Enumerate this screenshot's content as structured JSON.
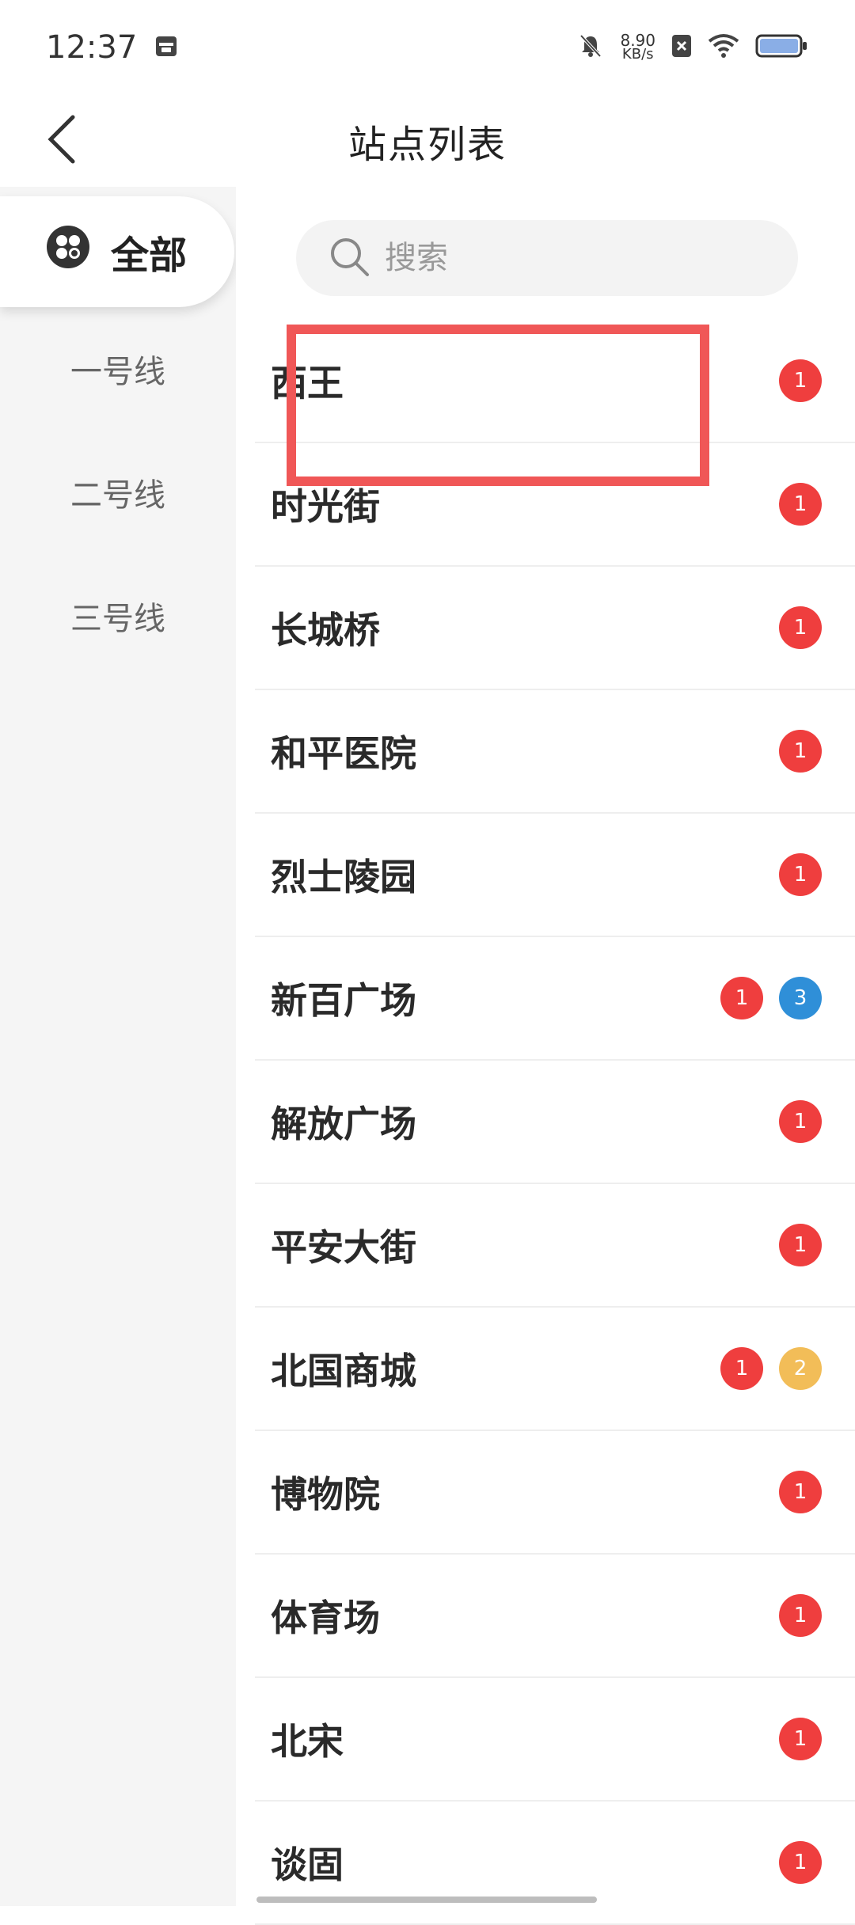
{
  "status_bar": {
    "time": "12:37",
    "speed_value": "8.90",
    "speed_unit": "KB/s"
  },
  "header": {
    "title": "站点列表"
  },
  "sidebar": {
    "items": [
      {
        "label": "全部",
        "active": true
      },
      {
        "label": "一号线"
      },
      {
        "label": "二号线"
      },
      {
        "label": "三号线"
      }
    ]
  },
  "search": {
    "placeholder": "搜索"
  },
  "colors": {
    "red": "#ef3e3e",
    "blue": "#2f8fd8",
    "yellow": "#f2bd58",
    "highlight": "#f05757"
  },
  "stations": [
    {
      "name": "西王",
      "badges": [
        {
          "value": "1",
          "color": "red"
        }
      ]
    },
    {
      "name": "时光街",
      "badges": [
        {
          "value": "1",
          "color": "red"
        }
      ]
    },
    {
      "name": "长城桥",
      "badges": [
        {
          "value": "1",
          "color": "red"
        }
      ]
    },
    {
      "name": "和平医院",
      "badges": [
        {
          "value": "1",
          "color": "red"
        }
      ]
    },
    {
      "name": "烈士陵园",
      "badges": [
        {
          "value": "1",
          "color": "red"
        }
      ]
    },
    {
      "name": "新百广场",
      "badges": [
        {
          "value": "1",
          "color": "red"
        },
        {
          "value": "3",
          "color": "blue"
        }
      ]
    },
    {
      "name": "解放广场",
      "badges": [
        {
          "value": "1",
          "color": "red"
        }
      ]
    },
    {
      "name": "平安大街",
      "badges": [
        {
          "value": "1",
          "color": "red"
        }
      ]
    },
    {
      "name": "北国商城",
      "badges": [
        {
          "value": "1",
          "color": "red"
        },
        {
          "value": "2",
          "color": "yellow"
        }
      ]
    },
    {
      "name": "博物院",
      "badges": [
        {
          "value": "1",
          "color": "red"
        }
      ]
    },
    {
      "name": "体育场",
      "badges": [
        {
          "value": "1",
          "color": "red"
        }
      ]
    },
    {
      "name": "北宋",
      "badges": [
        {
          "value": "1",
          "color": "red"
        }
      ]
    },
    {
      "name": "谈固",
      "badges": [
        {
          "value": "1",
          "color": "red"
        }
      ]
    }
  ]
}
